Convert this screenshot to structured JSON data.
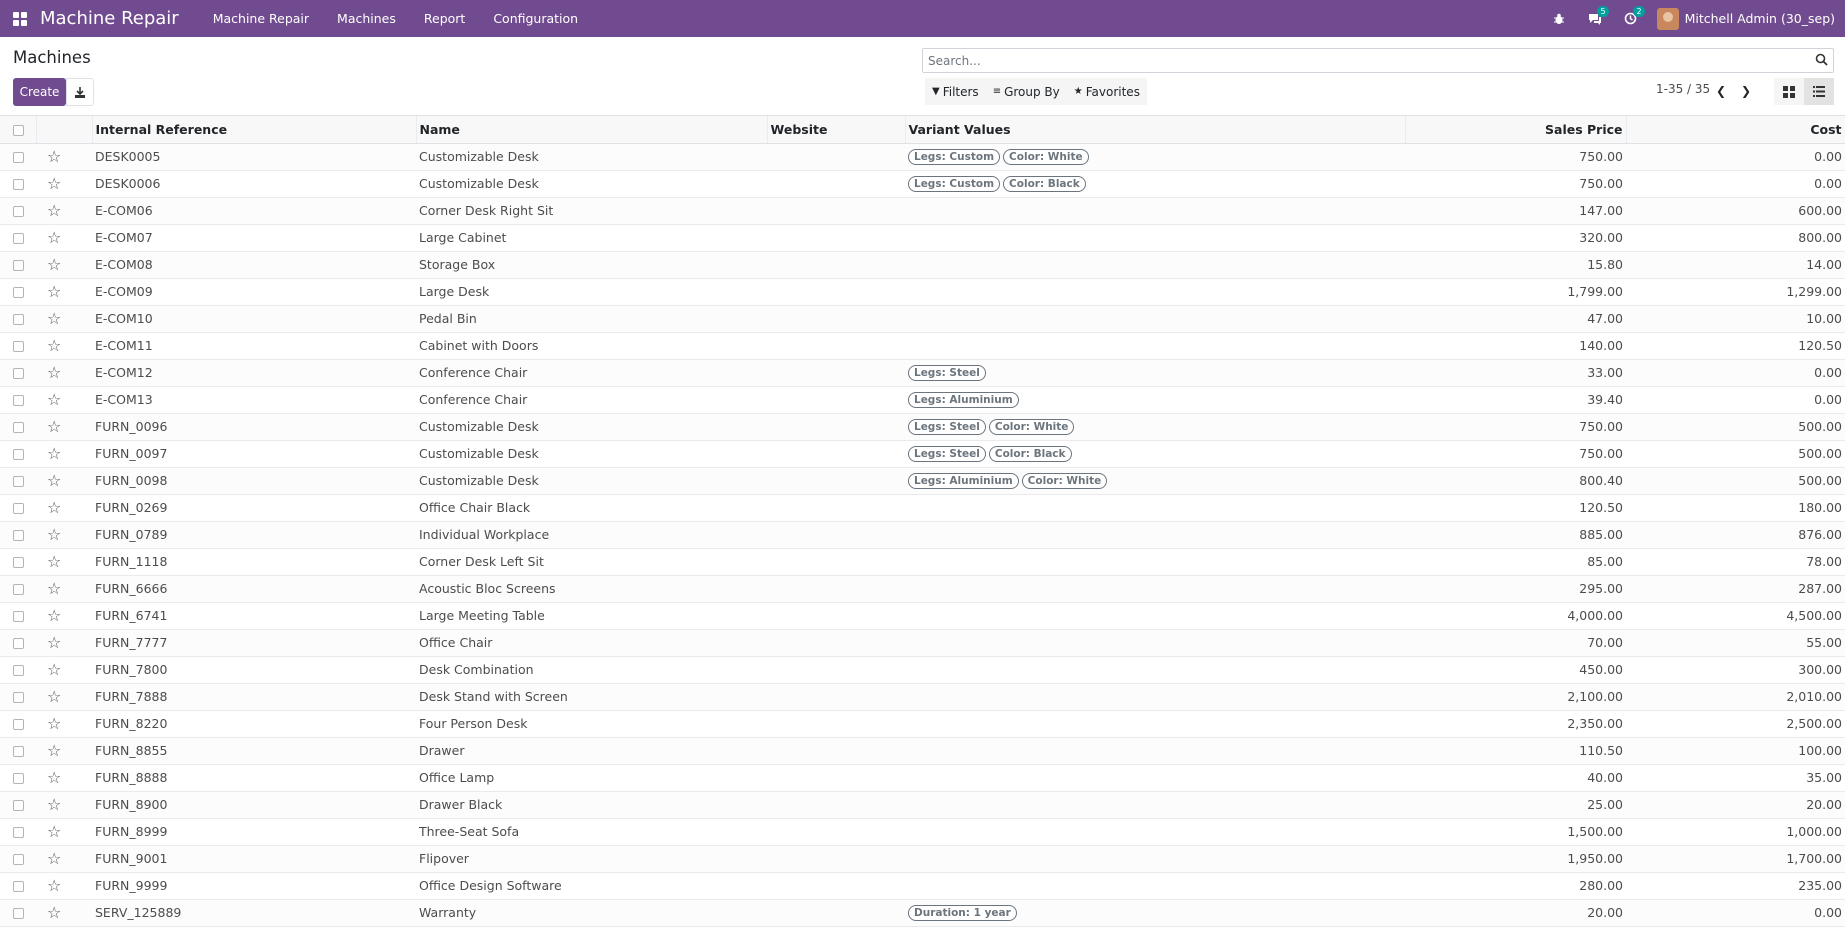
{
  "navbar": {
    "brand": "Machine Repair",
    "menu": [
      "Machine Repair",
      "Machines",
      "Report",
      "Configuration"
    ],
    "messages_count": "5",
    "activities_count": "2",
    "user_name": "Mitchell Admin (30_sep)"
  },
  "control_panel": {
    "title": "Machines",
    "create_label": "Create",
    "search_placeholder": "Search...",
    "filters_label": "Filters",
    "groupby_label": "Group By",
    "favorites_label": "Favorites",
    "pager": "1-35 / 35"
  },
  "table": {
    "columns": {
      "ref": "Internal Reference",
      "name": "Name",
      "website": "Website",
      "variants": "Variant Values",
      "price": "Sales Price",
      "cost": "Cost"
    },
    "rows": [
      {
        "ref": "DESK0005",
        "name": "Customizable Desk",
        "tags": [
          "Legs: Custom",
          "Color: White"
        ],
        "price": "750.00",
        "cost": "0.00"
      },
      {
        "ref": "DESK0006",
        "name": "Customizable Desk",
        "tags": [
          "Legs: Custom",
          "Color: Black"
        ],
        "price": "750.00",
        "cost": "0.00"
      },
      {
        "ref": "E-COM06",
        "name": "Corner Desk Right Sit",
        "tags": [],
        "price": "147.00",
        "cost": "600.00"
      },
      {
        "ref": "E-COM07",
        "name": "Large Cabinet",
        "tags": [],
        "price": "320.00",
        "cost": "800.00"
      },
      {
        "ref": "E-COM08",
        "name": "Storage Box",
        "tags": [],
        "price": "15.80",
        "cost": "14.00"
      },
      {
        "ref": "E-COM09",
        "name": "Large Desk",
        "tags": [],
        "price": "1,799.00",
        "cost": "1,299.00"
      },
      {
        "ref": "E-COM10",
        "name": "Pedal Bin",
        "tags": [],
        "price": "47.00",
        "cost": "10.00"
      },
      {
        "ref": "E-COM11",
        "name": "Cabinet with Doors",
        "tags": [],
        "price": "140.00",
        "cost": "120.50"
      },
      {
        "ref": "E-COM12",
        "name": "Conference Chair",
        "tags": [
          "Legs: Steel"
        ],
        "price": "33.00",
        "cost": "0.00"
      },
      {
        "ref": "E-COM13",
        "name": "Conference Chair",
        "tags": [
          "Legs: Aluminium"
        ],
        "price": "39.40",
        "cost": "0.00"
      },
      {
        "ref": "FURN_0096",
        "name": "Customizable Desk",
        "tags": [
          "Legs: Steel",
          "Color: White"
        ],
        "price": "750.00",
        "cost": "500.00"
      },
      {
        "ref": "FURN_0097",
        "name": "Customizable Desk",
        "tags": [
          "Legs: Steel",
          "Color: Black"
        ],
        "price": "750.00",
        "cost": "500.00"
      },
      {
        "ref": "FURN_0098",
        "name": "Customizable Desk",
        "tags": [
          "Legs: Aluminium",
          "Color: White"
        ],
        "price": "800.40",
        "cost": "500.00"
      },
      {
        "ref": "FURN_0269",
        "name": "Office Chair Black",
        "tags": [],
        "price": "120.50",
        "cost": "180.00"
      },
      {
        "ref": "FURN_0789",
        "name": "Individual Workplace",
        "tags": [],
        "price": "885.00",
        "cost": "876.00"
      },
      {
        "ref": "FURN_1118",
        "name": "Corner Desk Left Sit",
        "tags": [],
        "price": "85.00",
        "cost": "78.00"
      },
      {
        "ref": "FURN_6666",
        "name": "Acoustic Bloc Screens",
        "tags": [],
        "price": "295.00",
        "cost": "287.00"
      },
      {
        "ref": "FURN_6741",
        "name": "Large Meeting Table",
        "tags": [],
        "price": "4,000.00",
        "cost": "4,500.00"
      },
      {
        "ref": "FURN_7777",
        "name": "Office Chair",
        "tags": [],
        "price": "70.00",
        "cost": "55.00"
      },
      {
        "ref": "FURN_7800",
        "name": "Desk Combination",
        "tags": [],
        "price": "450.00",
        "cost": "300.00"
      },
      {
        "ref": "FURN_7888",
        "name": "Desk Stand with Screen",
        "tags": [],
        "price": "2,100.00",
        "cost": "2,010.00"
      },
      {
        "ref": "FURN_8220",
        "name": "Four Person Desk",
        "tags": [],
        "price": "2,350.00",
        "cost": "2,500.00"
      },
      {
        "ref": "FURN_8855",
        "name": "Drawer",
        "tags": [],
        "price": "110.50",
        "cost": "100.00"
      },
      {
        "ref": "FURN_8888",
        "name": "Office Lamp",
        "tags": [],
        "price": "40.00",
        "cost": "35.00"
      },
      {
        "ref": "FURN_8900",
        "name": "Drawer Black",
        "tags": [],
        "price": "25.00",
        "cost": "20.00"
      },
      {
        "ref": "FURN_8999",
        "name": "Three-Seat Sofa",
        "tags": [],
        "price": "1,500.00",
        "cost": "1,000.00"
      },
      {
        "ref": "FURN_9001",
        "name": "Flipover",
        "tags": [],
        "price": "1,950.00",
        "cost": "1,700.00"
      },
      {
        "ref": "FURN_9999",
        "name": "Office Design Software",
        "tags": [],
        "price": "280.00",
        "cost": "235.00"
      },
      {
        "ref": "SERV_125889",
        "name": "Warranty",
        "tags": [
          "Duration: 1 year"
        ],
        "price": "20.00",
        "cost": "0.00"
      }
    ]
  }
}
